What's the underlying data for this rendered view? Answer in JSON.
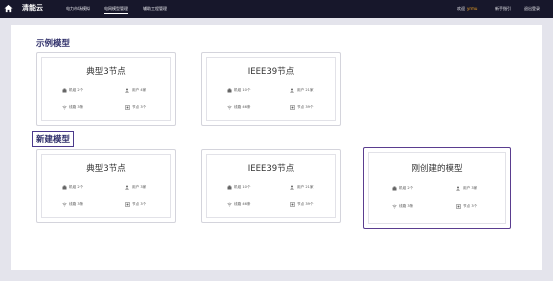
{
  "header": {
    "brand": "清能云",
    "nav": [
      "电力市场模拟",
      "电网模型管理",
      "辅助工程管理"
    ],
    "welcome": "欢迎",
    "username": "yrmu",
    "help": "新手指引",
    "logout": "退出登录"
  },
  "sections": {
    "examples_title": "示例模型",
    "new_title": "新建模型"
  },
  "example_cards": [
    {
      "title": "典型3节点",
      "units": "机组 2个",
      "users": "用户 4家",
      "lines": "线路 3条",
      "nodes": "节点 3个"
    },
    {
      "title": "IEEE39节点",
      "units": "机组 10个",
      "users": "用户 21家",
      "lines": "线路 46条",
      "nodes": "节点 39个"
    }
  ],
  "new_cards": [
    {
      "title": "典型3节点",
      "units": "机组 2个",
      "users": "用户 3家",
      "lines": "线路 3条",
      "nodes": "节点 3个"
    },
    {
      "title": "IEEE39节点",
      "units": "机组 10个",
      "users": "用户 21家",
      "lines": "线路 46条",
      "nodes": "节点 39个"
    },
    {
      "title": "刚创建的模型",
      "units": "机组 2个",
      "users": "用户 3家",
      "lines": "线路 3条",
      "nodes": "节点 3个"
    }
  ],
  "colors": {
    "topbar": "#17172b",
    "accent": "#5a3d8f",
    "username": "#f5a623"
  }
}
